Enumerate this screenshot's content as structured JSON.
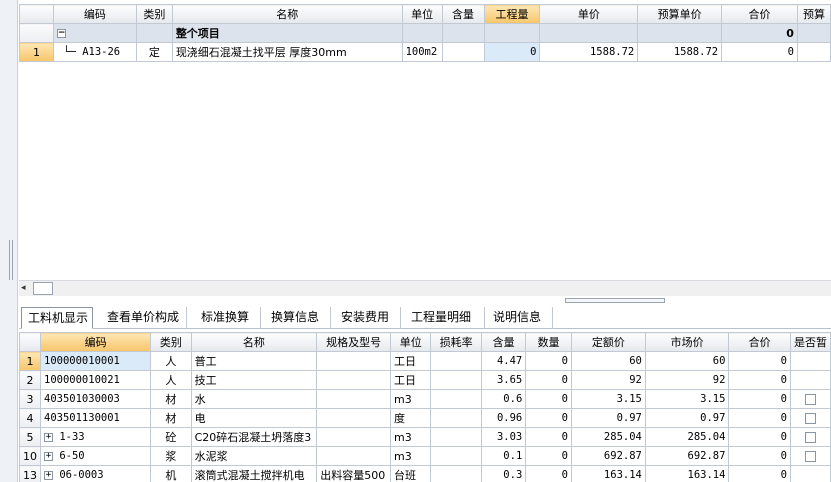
{
  "top_table": {
    "headers": [
      "",
      "编码",
      "类别",
      "名称",
      "单位",
      "含量",
      "工程量",
      "单价",
      "预算单价",
      "合价",
      "预算"
    ],
    "group_row": {
      "toggle": "−",
      "name": "整个项目",
      "total": "0"
    },
    "rows": [
      {
        "row_no": "1",
        "code": "A13-26",
        "category": "定",
        "name": "现浇细石混凝土找平层 厚度30mm",
        "unit": "100m2",
        "content": "",
        "quantity": "0",
        "unit_price": "1588.72",
        "budget_unit_price": "1588.72",
        "total": "0"
      }
    ]
  },
  "scrollbar": {
    "left_arrow": "◂"
  },
  "tabs": [
    "工料机显示",
    "查看单价构成",
    "标准换算",
    "换算信息",
    "安装费用",
    "工程量明细",
    "说明信息"
  ],
  "bottom_table": {
    "headers": [
      "",
      "编码",
      "类别",
      "名称",
      "规格及型号",
      "单位",
      "损耗率",
      "含量",
      "数量",
      "定额价",
      "市场价",
      "合价",
      "是否暂"
    ],
    "rows": [
      {
        "row_no": "1",
        "expand": "",
        "code": "100000010001",
        "category": "人",
        "name": "普工",
        "spec": "",
        "unit": "工日",
        "loss": "",
        "content": "4.47",
        "qty": "0",
        "quota_price": "60",
        "market_price": "60",
        "total": "0",
        "provisional": false
      },
      {
        "row_no": "2",
        "expand": "",
        "code": "100000010021",
        "category": "人",
        "name": "技工",
        "spec": "",
        "unit": "工日",
        "loss": "",
        "content": "3.65",
        "qty": "0",
        "quota_price": "92",
        "market_price": "92",
        "total": "0",
        "provisional": false
      },
      {
        "row_no": "3",
        "expand": "",
        "code": "403501030003",
        "category": "材",
        "name": "水",
        "spec": "",
        "unit": "m3",
        "loss": "",
        "content": "0.6",
        "qty": "0",
        "quota_price": "3.15",
        "market_price": "3.15",
        "total": "0",
        "provisional": true
      },
      {
        "row_no": "4",
        "expand": "",
        "code": "403501130001",
        "category": "材",
        "name": "电",
        "spec": "",
        "unit": "度",
        "loss": "",
        "content": "0.96",
        "qty": "0",
        "quota_price": "0.97",
        "market_price": "0.97",
        "total": "0",
        "provisional": true
      },
      {
        "row_no": "5",
        "expand": "+",
        "code": "1-33",
        "category": "砼",
        "name": "C20碎石混凝土坍落度3",
        "spec": "",
        "unit": "m3",
        "loss": "",
        "content": "3.03",
        "qty": "0",
        "quota_price": "285.04",
        "market_price": "285.04",
        "total": "0",
        "provisional": true
      },
      {
        "row_no": "10",
        "expand": "+",
        "code": "6-50",
        "category": "浆",
        "name": "水泥浆",
        "spec": "",
        "unit": "m3",
        "loss": "",
        "content": "0.1",
        "qty": "0",
        "quota_price": "692.87",
        "market_price": "692.87",
        "total": "0",
        "provisional": true
      },
      {
        "row_no": "13",
        "expand": "+",
        "code": "06-0003",
        "category": "机",
        "name": "滚筒式混凝土搅拌机电",
        "spec": "出料容量500",
        "unit": "台班",
        "loss": "",
        "content": "0.3",
        "qty": "0",
        "quota_price": "163.14",
        "market_price": "163.14",
        "total": "0",
        "provisional": false
      }
    ]
  }
}
